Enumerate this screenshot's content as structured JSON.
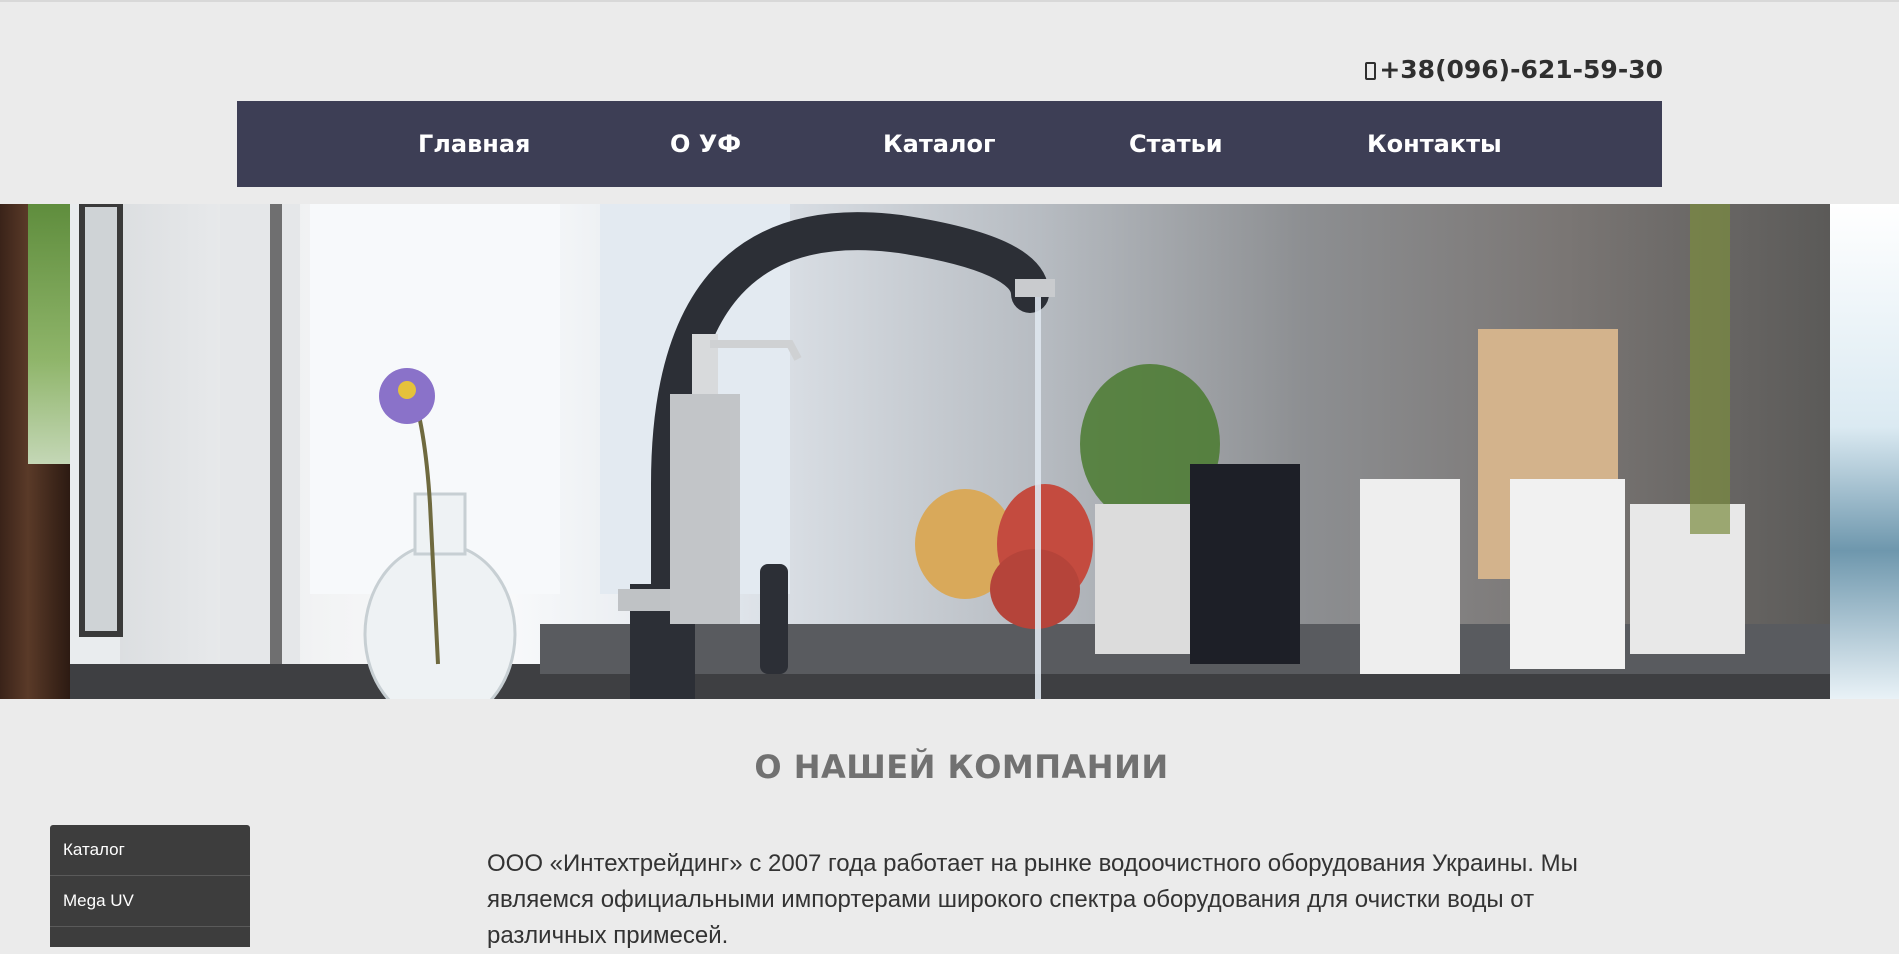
{
  "header": {
    "phone": "+38(096)-621-59-30"
  },
  "nav": {
    "items": [
      {
        "label": "Главная"
      },
      {
        "label": "О УФ"
      },
      {
        "label": "Каталог"
      },
      {
        "label": "Статьи"
      },
      {
        "label": "Контакты"
      }
    ]
  },
  "hero": {
    "image": "kitchen-faucet-banner"
  },
  "main": {
    "title": "О НАШЕЙ КОМПАНИИ",
    "text": "ООО «Интехтрейдинг» с 2007 года работает на рынке водоочистного оборудования Украины. Мы являемся официальными импортерами широкого спектра оборудования для очистки воды от различных примесей."
  },
  "sidebar": {
    "items": [
      {
        "label": "Каталог"
      },
      {
        "label": "Mega UV"
      }
    ]
  },
  "colors": {
    "background": "#ebebeb",
    "nav": "#3d3e55",
    "sidebar": "#3d3d3d",
    "title": "#717171"
  }
}
